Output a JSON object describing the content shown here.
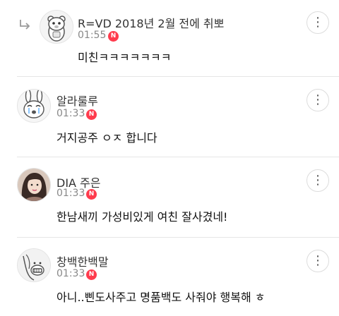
{
  "comments": [
    {
      "author": "R=VD 2018년 2월 전에 취뽀",
      "time": "01:55",
      "badge": "N",
      "body": "미친ㅋㅋㅋㅋㅋㅋㅋ",
      "avatar_icon": "bear-character-icon",
      "is_reply": true
    },
    {
      "author": "알라룰루",
      "time": "01:33",
      "badge": "N",
      "body": "거지공주 ㅇㅈ 합니다",
      "avatar_icon": "crying-bunny-icon",
      "is_reply": false
    },
    {
      "author": "DIA 주은",
      "time": "01:33",
      "badge": "N",
      "body": "한남새끼 가성비있게 여친 잘사겼네!",
      "avatar_icon": "profile-photo",
      "is_reply": false
    },
    {
      "author": "창백한백말",
      "time": "01:33",
      "badge": "N",
      "body": "아니..삔도사주고 명품백도 사줘야 행복해 ㅎ",
      "avatar_icon": "pale-face-icon",
      "is_reply": false
    }
  ],
  "more_icon": "more-options-icon",
  "more_glyph": "⋮"
}
